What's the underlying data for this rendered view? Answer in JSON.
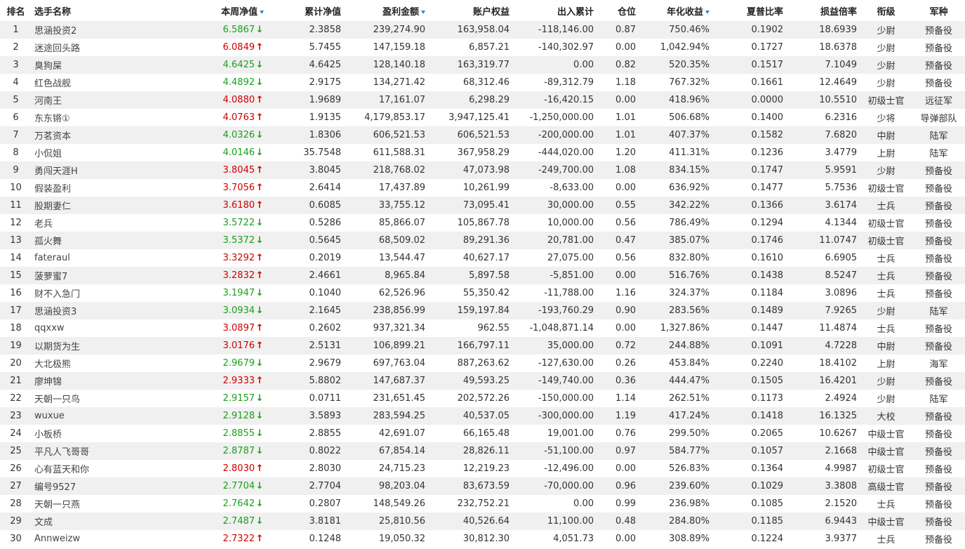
{
  "headers": {
    "rank": "排名",
    "name": "选手名称",
    "weekly_nav": "本周净值",
    "cum_nav": "累计净值",
    "profit": "盈利金额",
    "equity": "账户权益",
    "inout": "出入累计",
    "position": "仓位",
    "annual": "年化收益",
    "sharpe": "夏普比率",
    "pl_ratio": "损益倍率",
    "rank_title": "衔级",
    "branch": "军种"
  },
  "colors": {
    "up": "#d00000",
    "down": "#1aa01a",
    "sort_icon": "#2a8ad6",
    "row_alt": "#f0f0f0"
  },
  "rows": [
    {
      "rank": "1",
      "name": "思涵投资2",
      "weekly_nav": "6.5867",
      "dir": "down",
      "cum_nav": "2.3858",
      "profit": "239,274.90",
      "equity": "163,958.04",
      "inout": "-118,146.00",
      "position": "0.87",
      "annual": "750.46%",
      "sharpe": "0.1902",
      "pl_ratio": "18.6939",
      "rank_title": "少尉",
      "branch": "预备役"
    },
    {
      "rank": "2",
      "name": "迷途回头路",
      "weekly_nav": "6.0849",
      "dir": "up",
      "cum_nav": "5.7455",
      "profit": "147,159.18",
      "equity": "6,857.21",
      "inout": "-140,302.97",
      "position": "0.00",
      "annual": "1,042.94%",
      "sharpe": "0.1727",
      "pl_ratio": "18.6378",
      "rank_title": "少尉",
      "branch": "预备役"
    },
    {
      "rank": "3",
      "name": "臭狗屎",
      "weekly_nav": "4.6425",
      "dir": "down",
      "cum_nav": "4.6425",
      "profit": "128,140.18",
      "equity": "163,319.77",
      "inout": "0.00",
      "position": "0.82",
      "annual": "520.35%",
      "sharpe": "0.1517",
      "pl_ratio": "7.1049",
      "rank_title": "少尉",
      "branch": "预备役"
    },
    {
      "rank": "4",
      "name": "红色战舰",
      "weekly_nav": "4.4892",
      "dir": "down",
      "cum_nav": "2.9175",
      "profit": "134,271.42",
      "equity": "68,312.46",
      "inout": "-89,312.79",
      "position": "1.18",
      "annual": "767.32%",
      "sharpe": "0.1661",
      "pl_ratio": "12.4649",
      "rank_title": "少尉",
      "branch": "预备役"
    },
    {
      "rank": "5",
      "name": "河南王",
      "weekly_nav": "4.0880",
      "dir": "up",
      "cum_nav": "1.9689",
      "profit": "17,161.07",
      "equity": "6,298.29",
      "inout": "-16,420.15",
      "position": "0.00",
      "annual": "418.96%",
      "sharpe": "0.0000",
      "pl_ratio": "10.5510",
      "rank_title": "初级士官",
      "branch": "远征军"
    },
    {
      "rank": "6",
      "name": "东东锵①",
      "weekly_nav": "4.0763",
      "dir": "up",
      "cum_nav": "1.9135",
      "profit": "4,179,853.17",
      "equity": "3,947,125.41",
      "inout": "-1,250,000.00",
      "position": "1.01",
      "annual": "506.68%",
      "sharpe": "0.1400",
      "pl_ratio": "6.2316",
      "rank_title": "少将",
      "branch": "导弹部队"
    },
    {
      "rank": "7",
      "name": "万茗资本",
      "weekly_nav": "4.0326",
      "dir": "down",
      "cum_nav": "1.8306",
      "profit": "606,521.53",
      "equity": "606,521.53",
      "inout": "-200,000.00",
      "position": "1.01",
      "annual": "407.37%",
      "sharpe": "0.1582",
      "pl_ratio": "7.6820",
      "rank_title": "中尉",
      "branch": "陆军"
    },
    {
      "rank": "8",
      "name": "小侃姐",
      "weekly_nav": "4.0146",
      "dir": "down",
      "cum_nav": "35.7548",
      "profit": "611,588.31",
      "equity": "367,958.29",
      "inout": "-444,020.00",
      "position": "1.20",
      "annual": "411.31%",
      "sharpe": "0.1236",
      "pl_ratio": "3.4779",
      "rank_title": "上尉",
      "branch": "陆军"
    },
    {
      "rank": "9",
      "name": "勇闯天涯H",
      "weekly_nav": "3.8045",
      "dir": "up",
      "cum_nav": "3.8045",
      "profit": "218,768.02",
      "equity": "47,073.98",
      "inout": "-249,700.00",
      "position": "1.08",
      "annual": "834.15%",
      "sharpe": "0.1747",
      "pl_ratio": "5.9591",
      "rank_title": "少尉",
      "branch": "预备役"
    },
    {
      "rank": "10",
      "name": "假装盈利",
      "weekly_nav": "3.7056",
      "dir": "up",
      "cum_nav": "2.6414",
      "profit": "17,437.89",
      "equity": "10,261.99",
      "inout": "-8,633.00",
      "position": "0.00",
      "annual": "636.92%",
      "sharpe": "0.1477",
      "pl_ratio": "5.7536",
      "rank_title": "初级士官",
      "branch": "预备役"
    },
    {
      "rank": "11",
      "name": "股期妻仁",
      "weekly_nav": "3.6180",
      "dir": "up",
      "cum_nav": "0.6085",
      "profit": "33,755.12",
      "equity": "73,095.41",
      "inout": "30,000.00",
      "position": "0.55",
      "annual": "342.22%",
      "sharpe": "0.1366",
      "pl_ratio": "3.6174",
      "rank_title": "士兵",
      "branch": "预备役"
    },
    {
      "rank": "12",
      "name": "老兵",
      "weekly_nav": "3.5722",
      "dir": "down",
      "cum_nav": "0.5286",
      "profit": "85,866.07",
      "equity": "105,867.78",
      "inout": "10,000.00",
      "position": "0.56",
      "annual": "786.49%",
      "sharpe": "0.1294",
      "pl_ratio": "4.1344",
      "rank_title": "初级士官",
      "branch": "预备役"
    },
    {
      "rank": "13",
      "name": "孤火舞",
      "weekly_nav": "3.5372",
      "dir": "down",
      "cum_nav": "0.5645",
      "profit": "68,509.02",
      "equity": "89,291.36",
      "inout": "20,781.00",
      "position": "0.47",
      "annual": "385.07%",
      "sharpe": "0.1746",
      "pl_ratio": "11.0747",
      "rank_title": "初级士官",
      "branch": "预备役"
    },
    {
      "rank": "14",
      "name": "fateraul",
      "weekly_nav": "3.3292",
      "dir": "up",
      "cum_nav": "0.2019",
      "profit": "13,544.47",
      "equity": "40,627.17",
      "inout": "27,075.00",
      "position": "0.56",
      "annual": "832.80%",
      "sharpe": "0.1610",
      "pl_ratio": "6.6905",
      "rank_title": "士兵",
      "branch": "预备役"
    },
    {
      "rank": "15",
      "name": "菠萝蜜7",
      "weekly_nav": "3.2832",
      "dir": "up",
      "cum_nav": "2.4661",
      "profit": "8,965.84",
      "equity": "5,897.58",
      "inout": "-5,851.00",
      "position": "0.00",
      "annual": "516.76%",
      "sharpe": "0.1438",
      "pl_ratio": "8.5247",
      "rank_title": "士兵",
      "branch": "预备役"
    },
    {
      "rank": "16",
      "name": "财不入急门",
      "weekly_nav": "3.1947",
      "dir": "down",
      "cum_nav": "0.1040",
      "profit": "62,526.96",
      "equity": "55,350.42",
      "inout": "-11,788.00",
      "position": "1.16",
      "annual": "324.37%",
      "sharpe": "0.1184",
      "pl_ratio": "3.0896",
      "rank_title": "士兵",
      "branch": "预备役"
    },
    {
      "rank": "17",
      "name": "思涵投资3",
      "weekly_nav": "3.0934",
      "dir": "down",
      "cum_nav": "2.1645",
      "profit": "238,856.99",
      "equity": "159,197.84",
      "inout": "-193,760.29",
      "position": "0.90",
      "annual": "283.56%",
      "sharpe": "0.1489",
      "pl_ratio": "7.9265",
      "rank_title": "少尉",
      "branch": "陆军"
    },
    {
      "rank": "18",
      "name": "qqxxw",
      "weekly_nav": "3.0897",
      "dir": "up",
      "cum_nav": "0.2602",
      "profit": "937,321.34",
      "equity": "962.55",
      "inout": "-1,048,871.14",
      "position": "0.00",
      "annual": "1,327.86%",
      "sharpe": "0.1447",
      "pl_ratio": "11.4874",
      "rank_title": "士兵",
      "branch": "预备役"
    },
    {
      "rank": "19",
      "name": "以期货为生",
      "weekly_nav": "3.0176",
      "dir": "up",
      "cum_nav": "2.5131",
      "profit": "106,899.21",
      "equity": "166,797.11",
      "inout": "35,000.00",
      "position": "0.72",
      "annual": "244.88%",
      "sharpe": "0.1091",
      "pl_ratio": "4.7228",
      "rank_title": "中尉",
      "branch": "预备役"
    },
    {
      "rank": "20",
      "name": "大北极熊",
      "weekly_nav": "2.9679",
      "dir": "down",
      "cum_nav": "2.9679",
      "profit": "697,763.04",
      "equity": "887,263.62",
      "inout": "-127,630.00",
      "position": "0.26",
      "annual": "453.84%",
      "sharpe": "0.2240",
      "pl_ratio": "18.4102",
      "rank_title": "上尉",
      "branch": "海军"
    },
    {
      "rank": "21",
      "name": "廖坤锦",
      "weekly_nav": "2.9333",
      "dir": "up",
      "cum_nav": "5.8802",
      "profit": "147,687.37",
      "equity": "49,593.25",
      "inout": "-149,740.00",
      "position": "0.36",
      "annual": "444.47%",
      "sharpe": "0.1505",
      "pl_ratio": "16.4201",
      "rank_title": "少尉",
      "branch": "预备役"
    },
    {
      "rank": "22",
      "name": "天朝一只鸟",
      "weekly_nav": "2.9157",
      "dir": "down",
      "cum_nav": "0.0711",
      "profit": "231,651.45",
      "equity": "202,572.26",
      "inout": "-150,000.00",
      "position": "1.14",
      "annual": "262.51%",
      "sharpe": "0.1173",
      "pl_ratio": "2.4924",
      "rank_title": "少尉",
      "branch": "陆军"
    },
    {
      "rank": "23",
      "name": "wuxue",
      "weekly_nav": "2.9128",
      "dir": "down",
      "cum_nav": "3.5893",
      "profit": "283,594.25",
      "equity": "40,537.05",
      "inout": "-300,000.00",
      "position": "1.19",
      "annual": "417.24%",
      "sharpe": "0.1418",
      "pl_ratio": "16.1325",
      "rank_title": "大校",
      "branch": "预备役"
    },
    {
      "rank": "24",
      "name": "小板桥",
      "weekly_nav": "2.8855",
      "dir": "down",
      "cum_nav": "2.8855",
      "profit": "42,691.07",
      "equity": "66,165.48",
      "inout": "19,001.00",
      "position": "0.76",
      "annual": "299.50%",
      "sharpe": "0.2065",
      "pl_ratio": "10.6267",
      "rank_title": "中级士官",
      "branch": "预备役"
    },
    {
      "rank": "25",
      "name": "平凡人飞哥哥",
      "weekly_nav": "2.8787",
      "dir": "down",
      "cum_nav": "0.8022",
      "profit": "67,854.14",
      "equity": "28,826.11",
      "inout": "-51,100.00",
      "position": "0.97",
      "annual": "584.77%",
      "sharpe": "0.1057",
      "pl_ratio": "2.1668",
      "rank_title": "中级士官",
      "branch": "预备役"
    },
    {
      "rank": "26",
      "name": "心有蓝天和你",
      "weekly_nav": "2.8030",
      "dir": "up",
      "cum_nav": "2.8030",
      "profit": "24,715.23",
      "equity": "12,219.23",
      "inout": "-12,496.00",
      "position": "0.00",
      "annual": "526.83%",
      "sharpe": "0.1364",
      "pl_ratio": "4.9987",
      "rank_title": "初级士官",
      "branch": "预备役"
    },
    {
      "rank": "27",
      "name": "编号9527",
      "weekly_nav": "2.7704",
      "dir": "down",
      "cum_nav": "2.7704",
      "profit": "98,203.04",
      "equity": "83,673.59",
      "inout": "-70,000.00",
      "position": "0.96",
      "annual": "239.60%",
      "sharpe": "0.1029",
      "pl_ratio": "3.3808",
      "rank_title": "高级士官",
      "branch": "预备役"
    },
    {
      "rank": "28",
      "name": "天朝一只燕",
      "weekly_nav": "2.7642",
      "dir": "down",
      "cum_nav": "0.2807",
      "profit": "148,549.26",
      "equity": "232,752.21",
      "inout": "0.00",
      "position": "0.99",
      "annual": "236.98%",
      "sharpe": "0.1085",
      "pl_ratio": "2.1520",
      "rank_title": "士兵",
      "branch": "预备役"
    },
    {
      "rank": "29",
      "name": "文成",
      "weekly_nav": "2.7487",
      "dir": "down",
      "cum_nav": "3.8181",
      "profit": "25,810.56",
      "equity": "40,526.64",
      "inout": "11,100.00",
      "position": "0.48",
      "annual": "284.80%",
      "sharpe": "0.1185",
      "pl_ratio": "6.9443",
      "rank_title": "中级士官",
      "branch": "预备役"
    },
    {
      "rank": "30",
      "name": "Annweizw",
      "weekly_nav": "2.7322",
      "dir": "up",
      "cum_nav": "0.1248",
      "profit": "19,050.32",
      "equity": "30,812.30",
      "inout": "4,051.73",
      "position": "0.00",
      "annual": "308.89%",
      "sharpe": "0.1224",
      "pl_ratio": "3.9377",
      "rank_title": "士兵",
      "branch": "预备役"
    }
  ]
}
